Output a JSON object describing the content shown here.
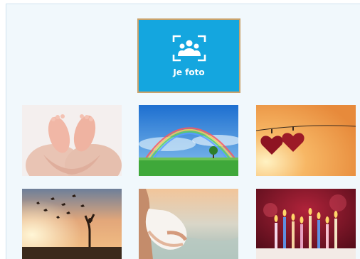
{
  "upload": {
    "label": "Je foto",
    "icon": "add-photo-people-icon",
    "background": "#14a6df",
    "border": "#c9a26b"
  },
  "photos": [
    {
      "name": "baby-feet-heart-hands",
      "selected": false
    },
    {
      "name": "rainbow-over-field",
      "selected": false
    },
    {
      "name": "hanging-felt-hearts",
      "selected": false
    },
    {
      "name": "woman-releasing-birds-sunset",
      "selected": false
    },
    {
      "name": "pregnant-belly-beach",
      "selected": false
    },
    {
      "name": "birthday-cake-candles",
      "selected": false
    }
  ]
}
